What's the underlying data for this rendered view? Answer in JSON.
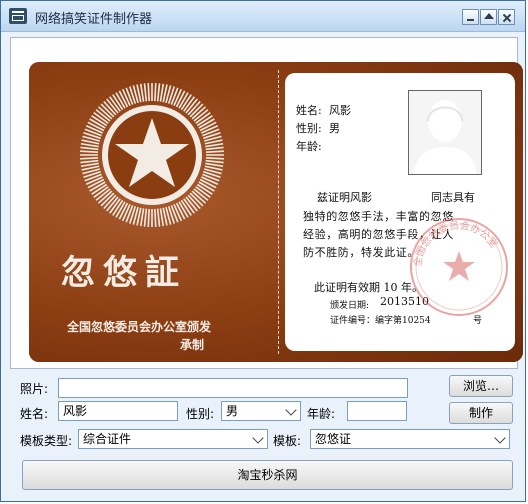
{
  "window": {
    "title": "网络搞笑证件制作器"
  },
  "card": {
    "title": "忽悠証",
    "issuer_line1": "全国忽悠委员会办公室颁发",
    "issuer_line2": "承制",
    "labels": {
      "name": "姓名:",
      "gender": "性别:",
      "age": "年龄:"
    },
    "name_value": "风影",
    "gender_value": "男",
    "age_value": "",
    "cert_line1_a": "兹证明风影",
    "cert_line1_b": "同志具有",
    "cert_line2": "独特的忽悠手法，丰富的忽悠",
    "cert_line3": "经验，高明的忽悠手段，让人",
    "cert_line4": "防不胜防，特发此证。",
    "validity": "此证明有效期 10 年。",
    "issue_date_label": "颁发日期:",
    "issue_date": "2013510",
    "cert_no_label": "证件编号：编字第10254",
    "cert_no_suffix": "号",
    "stamp_text": "全国忽悠委员会办公室"
  },
  "form": {
    "photo_label": "照片:",
    "photo_value": "",
    "browse_label": "浏览…",
    "name_label": "姓名:",
    "name_value": "风影",
    "gender_label": "性别:",
    "gender_value": "男",
    "age_label": "年龄:",
    "age_value": "",
    "make_label": "制作",
    "template_type_label": "模板类型:",
    "template_type_value": "综合证件",
    "template_label": "模板:",
    "template_value": "忽悠证",
    "shop_label": "淘宝秒杀网"
  }
}
